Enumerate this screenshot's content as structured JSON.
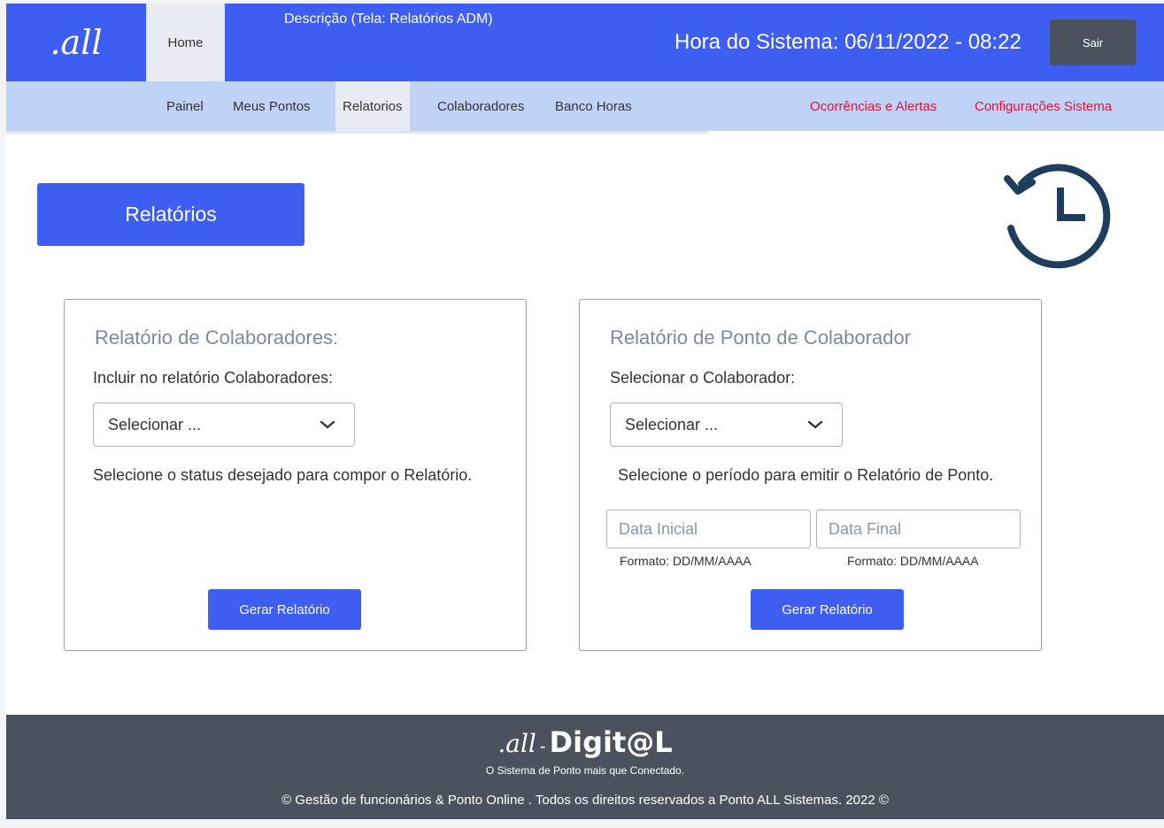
{
  "header": {
    "logo_text": ".all",
    "home_label": "Home",
    "description": "Descrição (Tela: Relatórios ADM)",
    "clock_label": "Hora do Sistema: 06/11/2022  -  08:22",
    "logout_label": "Sair"
  },
  "nav": {
    "items": [
      {
        "label": "Painel"
      },
      {
        "label": "Meus Pontos"
      },
      {
        "label": "Relatorios"
      },
      {
        "label": "Colaboradores"
      },
      {
        "label": "Banco Horas"
      },
      {
        "label": "Ocorrências e Alertas"
      },
      {
        "label": "Configurações Sistema"
      }
    ],
    "active": "Relatorios"
  },
  "page": {
    "title": "Relatórios",
    "history_icon": "history-clock-icon"
  },
  "panel_colaboradores": {
    "title": "Relatório de Colaboradores:",
    "label": "Incluir no relatório Colaboradores:",
    "select_value": "Selecionar ...",
    "hint": "Selecione o status desejado para compor o Relatório.",
    "button_label": "Gerar Relatório"
  },
  "panel_ponto": {
    "title": "Relatório de Ponto de Colaborador",
    "label": "Selecionar o Colaborador:",
    "select_value": "Selecionar ...",
    "hint": "Selecione o período para emitir o Relatório de Ponto.",
    "start_placeholder": "Data Inicial",
    "end_placeholder": "Data Final",
    "start_format": "Formato: DD/MM/AAAA",
    "end_format": "Formato: DD/MM/AAAA",
    "button_label": "Gerar Relatório"
  },
  "footer": {
    "logo_all": ".all",
    "logo_dash": "-",
    "logo_digital": "Digit@L",
    "tagline": "O Sistema de Ponto mais que Conectado.",
    "copyright": "© Gestão de funcionários & Ponto Online .  Todos os direitos reservados a Ponto ALL Sistemas.  2022 ©"
  },
  "colors": {
    "primary": "#3d5ef0",
    "nav_bg": "#c0d3f7",
    "alert": "#e01438",
    "footer_bg": "#4a535d",
    "icon": "#1f3d5c"
  }
}
